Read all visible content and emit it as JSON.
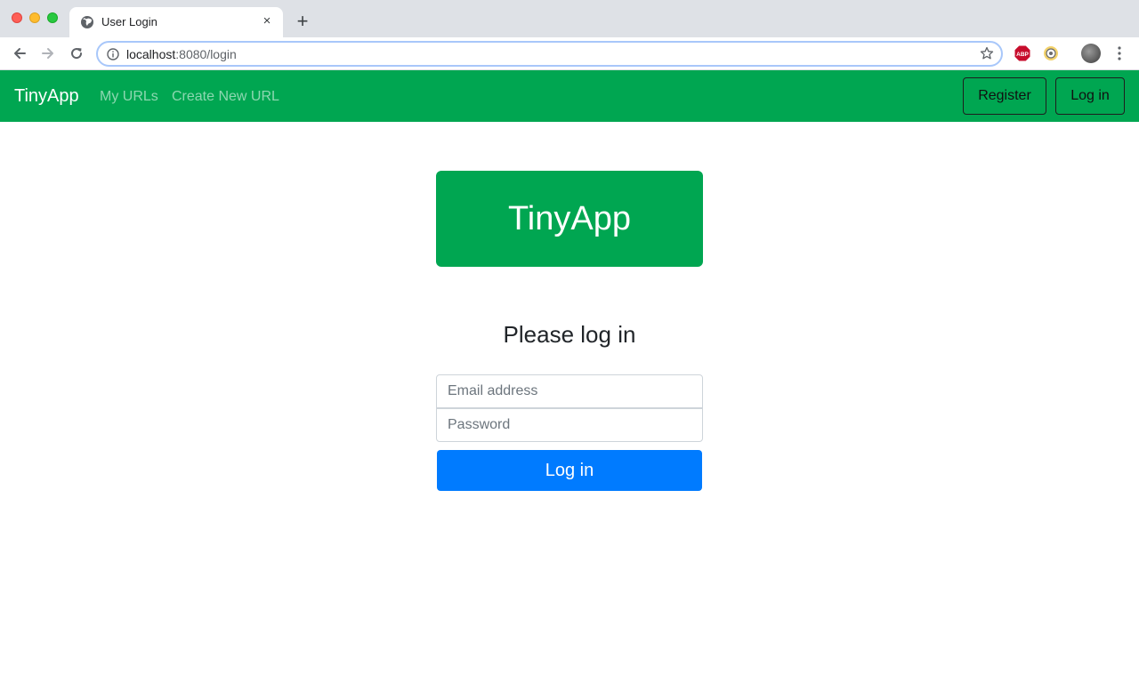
{
  "browser": {
    "tab": {
      "title": "User Login",
      "close_glyph": "×",
      "icon": "globe-icon"
    },
    "new_tab_glyph": "+",
    "address": {
      "host": "localhost",
      "path": ":8080/login"
    },
    "extensions": [
      "adblock-plus-icon",
      "extension-icon"
    ]
  },
  "navbar": {
    "brand": "TinyApp",
    "links": [
      "My URLs",
      "Create New URL"
    ],
    "register_label": "Register",
    "login_label": "Log in"
  },
  "main": {
    "hero_title": "TinyApp",
    "heading": "Please log in",
    "email_placeholder": "Email address",
    "password_placeholder": "Password",
    "submit_label": "Log in"
  },
  "colors": {
    "brand_green": "#00a651",
    "primary_blue": "#007bff"
  }
}
